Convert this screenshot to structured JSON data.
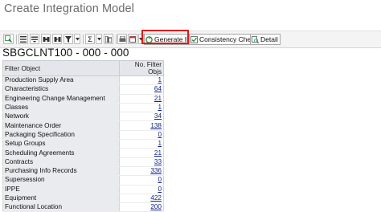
{
  "window": {
    "title": "Create Integration Model"
  },
  "toolbar": {
    "generate_label": "Generate IM",
    "consistency_label": "Consistency Check",
    "detail_label": "Detail",
    "sum_symbol": "Σ"
  },
  "model": {
    "name": "SBGCLNT100 - 000 - 000"
  },
  "table": {
    "headers": {
      "filter_object": "Filter Object",
      "count": "No. Filter Objs"
    },
    "rows": [
      {
        "name": "Production Supply Area",
        "count": "1"
      },
      {
        "name": "Characteristics",
        "count": "64"
      },
      {
        "name": "Engineering Change Management",
        "count": "21"
      },
      {
        "name": "Classes",
        "count": "1"
      },
      {
        "name": "Network",
        "count": "34"
      },
      {
        "name": "Maintenance Order",
        "count": "138"
      },
      {
        "name": "Packaging Specification",
        "count": "0"
      },
      {
        "name": "Setup Groups",
        "count": "1"
      },
      {
        "name": "Scheduling Agreements",
        "count": "21"
      },
      {
        "name": "Contracts",
        "count": "33"
      },
      {
        "name": "Purchasing Info Records",
        "count": "336"
      },
      {
        "name": "Supersession",
        "count": "0"
      },
      {
        "name": "IPPE",
        "count": "0"
      },
      {
        "name": "Equipment",
        "count": "422"
      },
      {
        "name": "Functional Location",
        "count": "200"
      }
    ]
  },
  "colors": {
    "highlight": "#e01818",
    "link": "#0a1f8a",
    "key_column_bg": "#e9ebee"
  }
}
